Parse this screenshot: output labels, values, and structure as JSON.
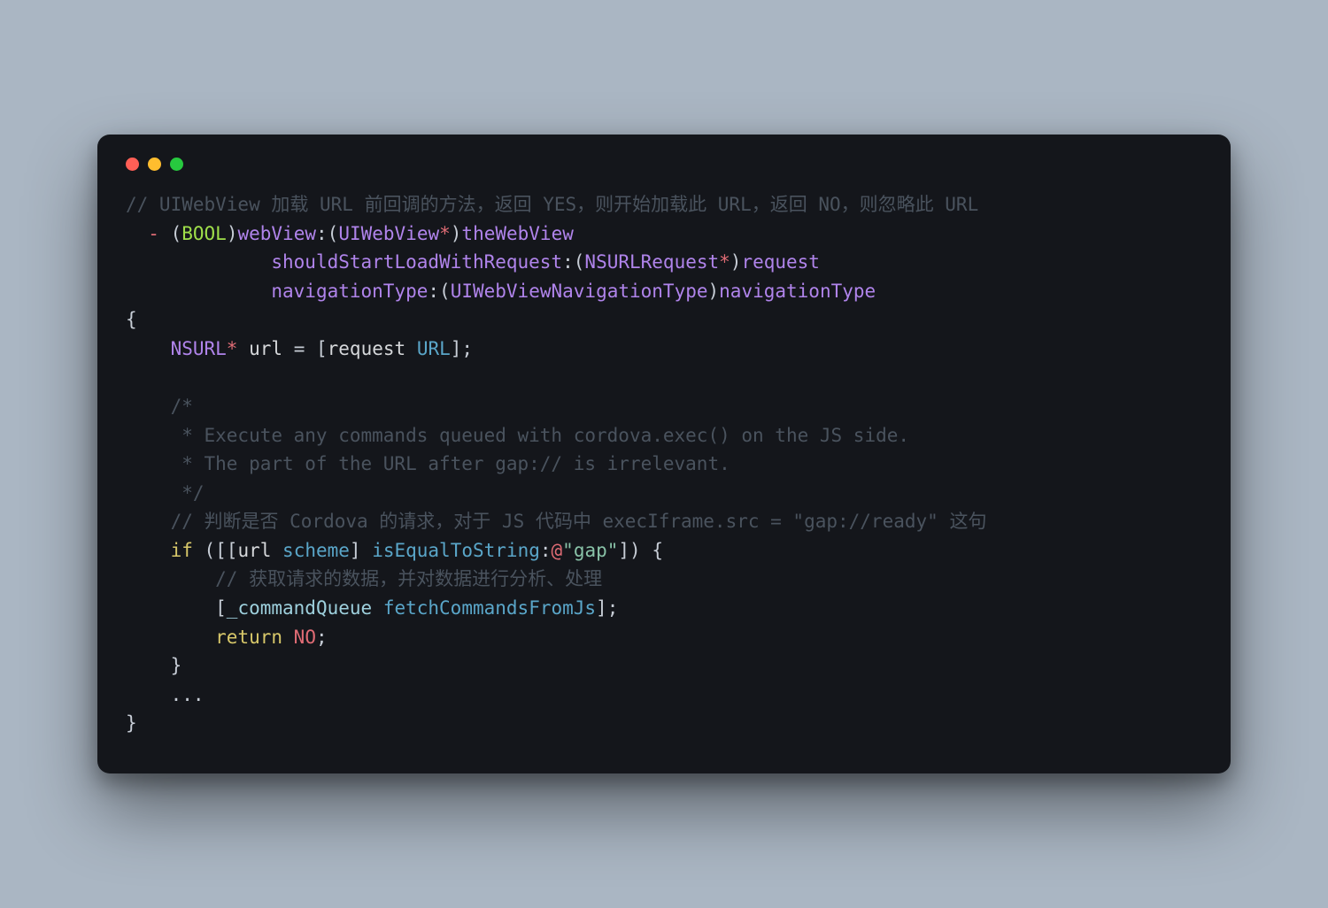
{
  "traffic": {
    "red": "#ff5f56",
    "yellow": "#ffbd2e",
    "green": "#27c93f"
  },
  "code": {
    "comment_top": "// UIWebView 加载 URL 前回调的方法，返回 YES，则开始加载此 URL，返回 NO，则忽略此 URL",
    "dash": "-",
    "open_paren_1": " (",
    "type_BOOL": "BOOL",
    "close_paren_1": ")",
    "sel_webView": "webView",
    "colon_1": ":",
    "open_paren_2": "(",
    "type_UIWebView": "UIWebView",
    "star_1": "*",
    "close_paren_2": ")",
    "arg_theWebView": "theWebView",
    "indent2": "             ",
    "sel_should": "shouldStartLoadWithRequest",
    "colon_2": ":",
    "open_paren_3": "(",
    "type_NSURLRequest": "NSURLRequest",
    "star_2": "*",
    "close_paren_3": ")",
    "arg_request": "request",
    "sel_nav": "navigationType",
    "colon_3": ":",
    "open_paren_4": "(",
    "type_UIWebViewNavType": "UIWebViewNavigationType",
    "close_paren_4": ")",
    "arg_navType": "navigationType",
    "brace_open": "{",
    "nsurl_indent": "    ",
    "type_NSURL": "NSURL",
    "star_3": "*",
    "sp1": " ",
    "id_url": "url",
    "sp_eq": " = ",
    "lb1": "[",
    "id_request": "request",
    "sp2": " ",
    "msg_URL": "URL",
    "rb1": "];",
    "blk_c1": "    /*",
    "blk_c2": "     * Execute any commands queued with cordova.exec() on the JS side.",
    "blk_c3": "     * The part of the URL after gap:// is irrelevant.",
    "blk_c4": "     */",
    "line_c5": "    // 判断是否 Cordova 的请求，对于 JS 代码中 execIframe.src = \"gap://ready\" 这句",
    "if_indent": "    ",
    "kw_if": "if",
    "if_open": " ([[",
    "id_url2": "url",
    "sp3": " ",
    "msg_scheme": "scheme",
    "if_mid": "] ",
    "msg_isEqual": "isEqualToString",
    "colon_4": ":",
    "at": "@",
    "str_gap": "\"gap\"",
    "if_close": "]) {",
    "inner_comment": "        // 获取请求的数据，并对数据进行分析、处理",
    "cq_indent": "        [",
    "id_cmdQueue": "_commandQueue",
    "sp4": " ",
    "msg_fetch": "fetchCommandsFromJs",
    "cq_close": "];",
    "ret_indent": "        ",
    "kw_return": "return",
    "sp5": " ",
    "const_NO": "NO",
    "semi": ";",
    "inner_brace_close": "    }",
    "ellipsis": "    ...",
    "brace_close": "}"
  }
}
